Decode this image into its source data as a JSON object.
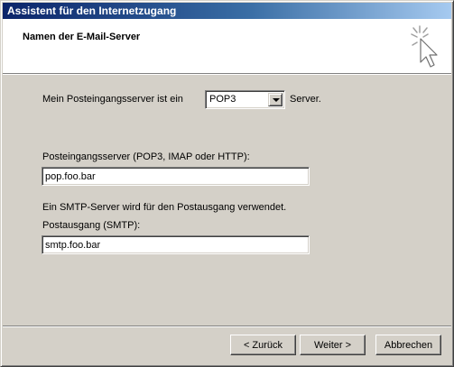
{
  "window": {
    "title": "Assistent für den Internetzugang"
  },
  "header": {
    "heading": "Namen der E-Mail-Server",
    "icon": "wizard-cursor-icon"
  },
  "incoming_type": {
    "label_before": "Mein Posteingangsserver ist ein",
    "selected": "POP3",
    "label_after": "Server."
  },
  "incoming_server": {
    "label": "Posteingangsserver (POP3, IMAP oder HTTP):",
    "value": "pop.foo.bar"
  },
  "outgoing_server": {
    "info": "Ein SMTP-Server wird für den Postausgang verwendet.",
    "label": "Postausgang (SMTP):",
    "value": "smtp.foo.bar"
  },
  "buttons": {
    "back": "< Zurück",
    "next": "Weiter >",
    "cancel": "Abbrechen"
  }
}
